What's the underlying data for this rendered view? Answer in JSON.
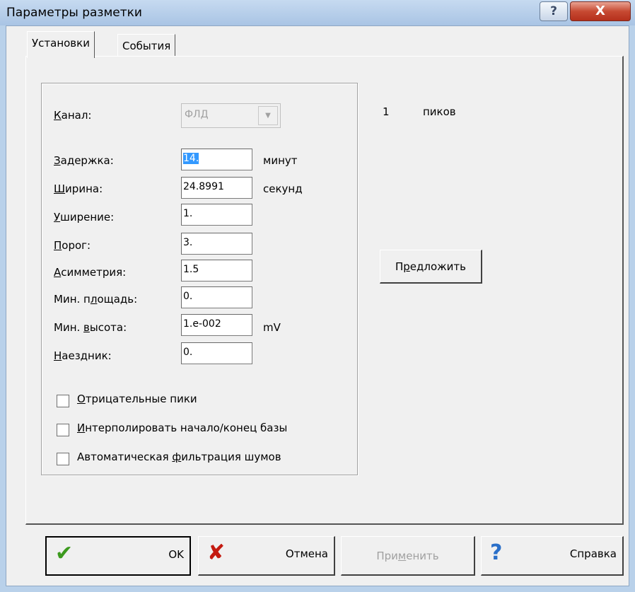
{
  "window": {
    "title": "Параметры разметки",
    "help_glyph": "?",
    "close_glyph": "X"
  },
  "tabs": [
    {
      "label": "Установки",
      "active": true
    },
    {
      "label": "События",
      "active": false
    }
  ],
  "fields": {
    "channel": {
      "label_hot": "К",
      "label_rest": "анал:",
      "value": "ФЛД"
    },
    "delay": {
      "label_hot": "З",
      "label_rest": "адержка:",
      "value": "14.",
      "unit": "минут"
    },
    "width": {
      "label_hot": "Ш",
      "label_rest": "ирина:",
      "value": "24.8991",
      "unit": "секунд"
    },
    "broadening": {
      "label_hot": "У",
      "label_rest": "ширение:",
      "value": "1."
    },
    "threshold": {
      "label_hot": "П",
      "label_rest": "орог:",
      "value": "3."
    },
    "asymmetry": {
      "label_hot": "А",
      "label_rest": "симметрия:",
      "value": "1.5"
    },
    "min_area": {
      "label_pre": "Мин. п",
      "label_hot": "л",
      "label_rest": "ощадь:",
      "value": "0."
    },
    "min_height": {
      "label_pre": "Мин. ",
      "label_hot": "в",
      "label_rest": "ысота:",
      "value": "1.e-002",
      "unit": "mV"
    },
    "rider": {
      "label_hot": "Н",
      "label_rest": "аездник:",
      "value": "0."
    }
  },
  "checkboxes": [
    {
      "pre": "",
      "hot": "О",
      "rest": "трицательные пики",
      "checked": false
    },
    {
      "pre": "",
      "hot": "И",
      "rest": "нтерполировать начало/конец базы",
      "checked": false
    },
    {
      "pre": "Автоматическая ",
      "hot": "ф",
      "rest": "ильтрация шумов",
      "checked": false
    }
  ],
  "peaks": {
    "count": "1",
    "label": "пиков"
  },
  "suggest_button": {
    "pre": "П",
    "hot": "р",
    "rest": "едложить"
  },
  "footer": {
    "ok": {
      "label": "OK",
      "icon": "check-icon"
    },
    "cancel": {
      "label": "Отмена",
      "icon": "cross-icon"
    },
    "apply": {
      "pre": "При",
      "hot": "м",
      "rest": "енить"
    },
    "help": {
      "label": "Справка",
      "icon": "question-icon"
    }
  },
  "colors": {
    "ok_check": "#3c9a1e",
    "cancel_cross": "#c41a10",
    "help_question": "#2a6fc9",
    "selection": "#3399ff"
  }
}
